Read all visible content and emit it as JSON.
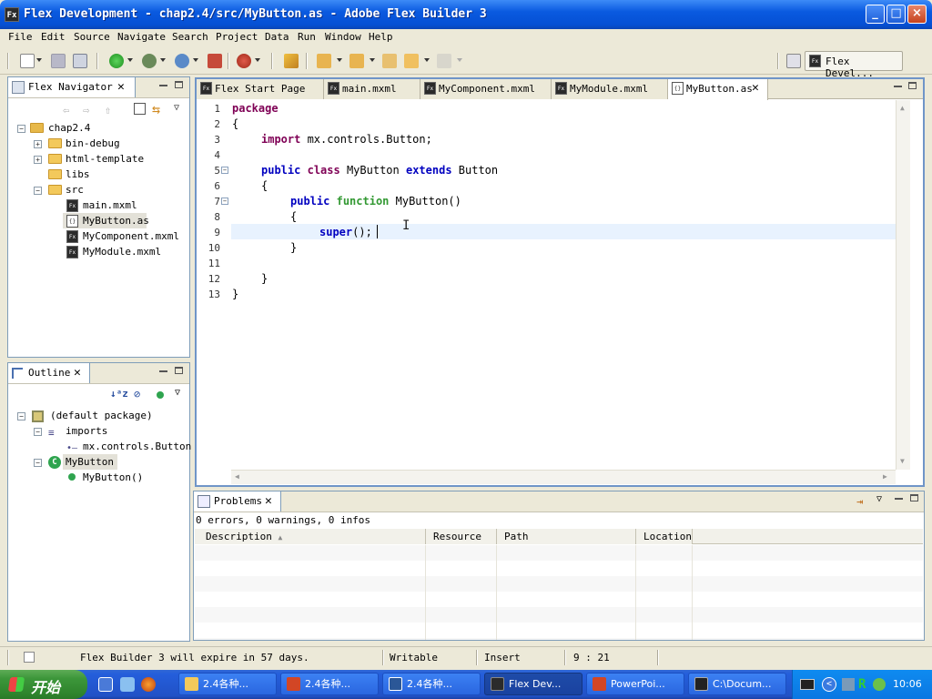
{
  "window": {
    "title": "Flex Development - chap2.4/src/MyButton.as - Adobe Flex Builder 3",
    "app_icon": "Fx",
    "controls": {
      "minimize": "_",
      "maximize": "□",
      "close": "×"
    }
  },
  "menu": [
    "File",
    "Edit",
    "Source",
    "Navigate",
    "Search",
    "Project",
    "Data",
    "Run",
    "Window",
    "Help"
  ],
  "perspective": {
    "label": "Flex Devel...",
    "icon": "Fx"
  },
  "navigator": {
    "title": "Flex Navigator",
    "tree": [
      {
        "label": "chap2.4",
        "type": "project",
        "expanded": true
      },
      {
        "label": "bin-debug",
        "type": "folder",
        "expanded": false
      },
      {
        "label": "html-template",
        "type": "folder",
        "expanded": false
      },
      {
        "label": "libs",
        "type": "folder"
      },
      {
        "label": "src",
        "type": "folder",
        "expanded": true
      },
      {
        "label": "main.mxml",
        "type": "mxml"
      },
      {
        "label": "MyButton.as",
        "type": "as",
        "selected": true
      },
      {
        "label": "MyComponent.mxml",
        "type": "mxml"
      },
      {
        "label": "MyModule.mxml",
        "type": "mxml"
      }
    ]
  },
  "outline": {
    "title": "Outline",
    "tree": [
      {
        "label": "(default package)"
      },
      {
        "label": "imports"
      },
      {
        "label": "mx.controls.Button"
      },
      {
        "label": "MyButton",
        "selected": true
      },
      {
        "label": "MyButton()"
      }
    ]
  },
  "editor": {
    "tabs": [
      {
        "label": "Flex Start Page",
        "active": false
      },
      {
        "label": "main.mxml",
        "active": false
      },
      {
        "label": "MyComponent.mxml",
        "active": false
      },
      {
        "label": "MyModule.mxml",
        "active": false
      },
      {
        "label": "MyButton.as",
        "active": true
      }
    ],
    "line_numbers": [
      "1",
      "2",
      "3",
      "4",
      "5",
      "6",
      "7",
      "8",
      "9",
      "10",
      "11",
      "12",
      "13"
    ],
    "code": {
      "l1_kw": "package",
      "l2": "{",
      "l3_kw": "import",
      "l3_rest": " mx.controls.Button;",
      "l5_kw1": "public",
      "l5_kw2": "class",
      "l5_name": " MyButton ",
      "l5_kw3": "extends",
      "l5_base": " Button",
      "l6": "{",
      "l7_kw1": "public",
      "l7_kw2": "function",
      "l7_name": " MyButton()",
      "l8": "{",
      "l9_kw": "super",
      "l9_rest": "();",
      "l10": "}",
      "l12": "}",
      "l13": "}"
    }
  },
  "problems": {
    "title": "Problems",
    "summary": "0 errors, 0 warnings, 0 infos",
    "columns": [
      "Description",
      "Resource",
      "Path",
      "Location"
    ]
  },
  "status": {
    "message": "Flex Builder 3 will expire in 57 days.",
    "writable": "Writable",
    "mode": "Insert",
    "position": "9 : 21"
  },
  "taskbar": {
    "start": "开始",
    "tasks": [
      {
        "label": "2.4各种...",
        "icon": "folder-icon",
        "color": "#f3c95b"
      },
      {
        "label": "2.4各种...",
        "icon": "powerpoint-icon",
        "color": "#d24625"
      },
      {
        "label": "2.4各种...",
        "icon": "word-icon",
        "color": "#2b5797"
      },
      {
        "label": "Flex Dev...",
        "icon": "flex-icon",
        "color": "#2b2b2b",
        "active": true
      },
      {
        "label": "PowerPoi...",
        "icon": "powerpoint-icon",
        "color": "#d24625"
      },
      {
        "label": "C:\\Docum...",
        "icon": "cmd-icon",
        "color": "#222"
      }
    ],
    "clock": "10:06"
  }
}
